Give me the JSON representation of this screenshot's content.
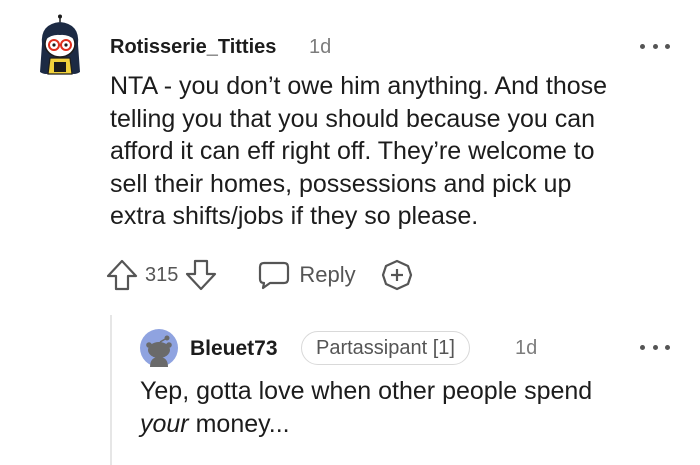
{
  "comment": {
    "username": "Rotisserie_Titties",
    "time": "1d",
    "body": "NTA - you don’t owe him anything. And those\ntelling you that you should because you can\nafford it can eff right off. They’re welcome to\nsell their homes, possessions and pick up\nextra shifts/jobs if they so please.",
    "vote_count": "315",
    "reply_label": "Reply",
    "icons": [
      "upvote-icon",
      "downvote-icon",
      "reply-icon",
      "award-icon",
      "more-options-icon"
    ]
  },
  "reply": {
    "username": "Bleuet73",
    "flair": "Partassipant [1]",
    "time": "1d",
    "body_before": "Yep, gotta love when other people spend",
    "body_emphasis": "your",
    "body_after": " money...",
    "icons": [
      "snoo-avatar-icon",
      "more-options-icon"
    ]
  },
  "colors": {
    "text": "#1c1c1c",
    "meta": "#7c7c7c",
    "icon": "#555555",
    "reply_avatar_bg": "#8fa3e0"
  }
}
